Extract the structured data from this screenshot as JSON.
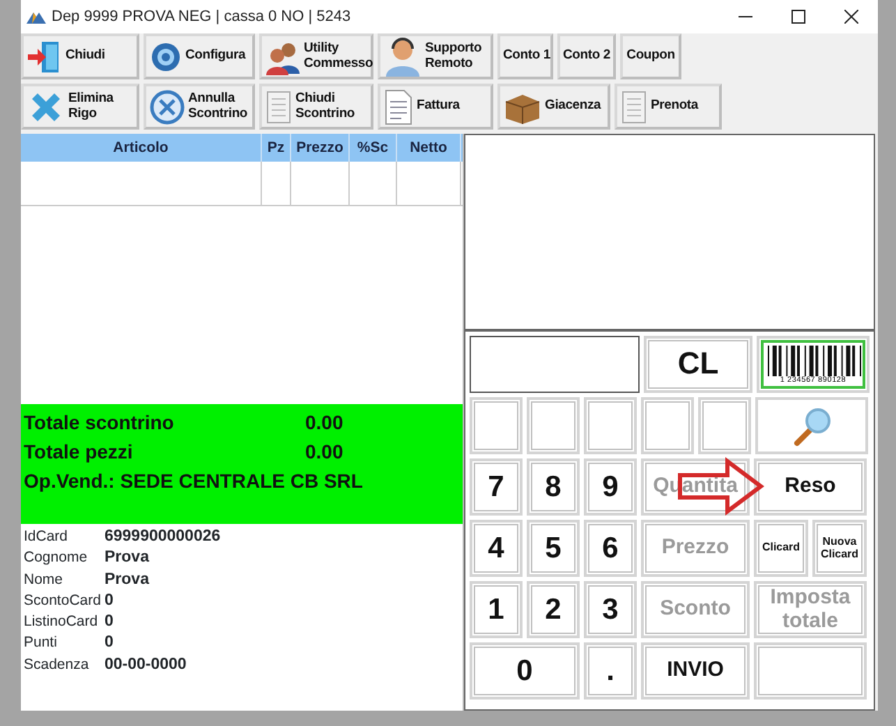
{
  "window": {
    "title": "Dep 9999 PROVA NEG | cassa 0 NO  | 5243"
  },
  "toolbar_rows": [
    [
      {
        "label": "Chiudi"
      },
      {
        "label": "Configura"
      },
      {
        "label": "Utility\nCommesso"
      },
      {
        "label": "Supporto\nRemoto"
      },
      {
        "label": "Conto 1"
      },
      {
        "label": "Conto 2"
      },
      {
        "label": "Coupon"
      }
    ],
    [
      {
        "label": "Elimina\nRigo"
      },
      {
        "label": "Annulla\nScontrino"
      },
      {
        "label": "Chiudi\nScontrino"
      },
      {
        "label": "Fattura"
      },
      {
        "label": "Giacenza"
      },
      {
        "label": "Prenota"
      }
    ]
  ],
  "table": {
    "columns": [
      "Articolo",
      "Pz",
      "Prezzo",
      "%Sc",
      "Netto"
    ]
  },
  "totals": [
    {
      "label": "Totale scontrino",
      "value": "0.00"
    },
    {
      "label": "Totale pezzi",
      "value": "0.00"
    },
    {
      "label": "Op.Vend.: SEDE CENTRALE CB SRL"
    }
  ],
  "card_info": [
    {
      "label": "IdCard",
      "value": "6999900000026"
    },
    {
      "label": "Cognome",
      "value": "Prova"
    },
    {
      "label": "Nome",
      "value": "Prova"
    },
    {
      "label": "ScontoCard",
      "value": "0"
    },
    {
      "label": "ListinoCard",
      "value": "0"
    },
    {
      "label": "Punti",
      "value": "0"
    },
    {
      "label": "Scadenza",
      "value": "00-00-0000"
    }
  ],
  "keypad": [
    [
      {
        "kind": "display"
      },
      {
        "kind": "key",
        "label": "CL",
        "disabled": false
      },
      {
        "kind": "barcode",
        "digits": "1 234567 890128",
        "highlighted": true
      }
    ],
    [
      {
        "kind": "key"
      },
      {
        "kind": "key"
      },
      {
        "kind": "key"
      },
      {
        "kind": "key"
      },
      {
        "kind": "key"
      },
      {
        "kind": "search"
      }
    ],
    [
      {
        "kind": "key",
        "label": "7",
        "disabled": false
      },
      {
        "kind": "key",
        "label": "8",
        "disabled": false
      },
      {
        "kind": "key",
        "label": "9",
        "disabled": false
      },
      {
        "kind": "key",
        "label": "Quantita",
        "disabled": true
      },
      {
        "kind": "key",
        "label": "Reso",
        "disabled": false
      }
    ],
    [
      {
        "kind": "key",
        "label": "4",
        "disabled": false
      },
      {
        "kind": "key",
        "label": "5",
        "disabled": false
      },
      {
        "kind": "key",
        "label": "6",
        "disabled": false
      },
      {
        "kind": "key",
        "label": "Prezzo",
        "disabled": true
      },
      {
        "kind": "key",
        "label": "Clicard",
        "disabled": false
      },
      {
        "kind": "key",
        "label": "Nuova\nClicard",
        "disabled": false
      }
    ],
    [
      {
        "kind": "key",
        "label": "1",
        "disabled": false
      },
      {
        "kind": "key",
        "label": "2",
        "disabled": false
      },
      {
        "kind": "key",
        "label": "3",
        "disabled": false
      },
      {
        "kind": "key",
        "label": "Sconto",
        "disabled": true
      },
      {
        "kind": "key",
        "label": "Imposta\ntotale",
        "disabled": true
      }
    ],
    [
      {
        "kind": "key",
        "label": "0",
        "disabled": false
      },
      {
        "kind": "key",
        "label": ".",
        "disabled": false
      },
      {
        "kind": "key",
        "label": "INVIO",
        "disabled": false
      },
      {
        "kind": "key"
      }
    ]
  ]
}
